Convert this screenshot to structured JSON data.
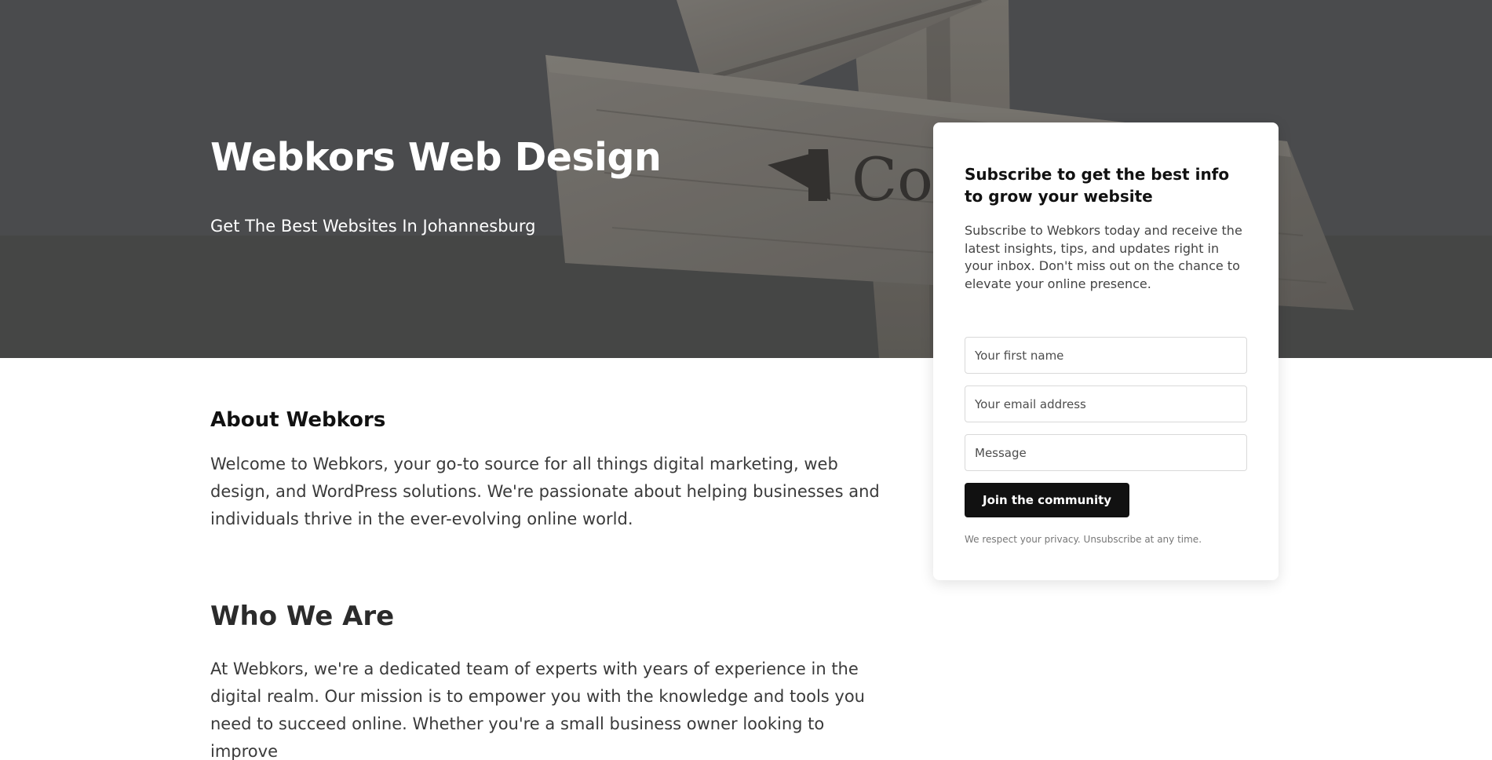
{
  "hero": {
    "title": "Webkors Web Design",
    "subtitle": "Get The Best Websites In Johannesburg",
    "sign_text": "Co"
  },
  "about": {
    "heading": "About Webkors",
    "body": "Welcome to Webkors, your go-to source for all things digital marketing, web design, and WordPress solutions. We're passionate about helping businesses and individuals thrive in the ever-evolving online world."
  },
  "who": {
    "heading": "Who We Are",
    "body": "At Webkors, we're a dedicated team of experts with years of experience in the digital realm. Our mission is to empower you with the knowledge and tools you need to succeed online. Whether you're a small business owner looking to improve"
  },
  "subscribe": {
    "title": "Subscribe to get the best info to grow your website",
    "description": "Subscribe to Webkors today and receive the latest insights, tips, and updates right in your inbox. Don't miss out on the chance to elevate your online presence.",
    "first_name_placeholder": "Your first name",
    "email_placeholder": "Your email address",
    "message_placeholder": "Message",
    "button_label": "Join the community",
    "privacy_note": "We respect your privacy. Unsubscribe at any time."
  },
  "colors": {
    "button_background": "#111111",
    "hero_overlay": "#4f5052",
    "text": "#3a3a3a"
  }
}
